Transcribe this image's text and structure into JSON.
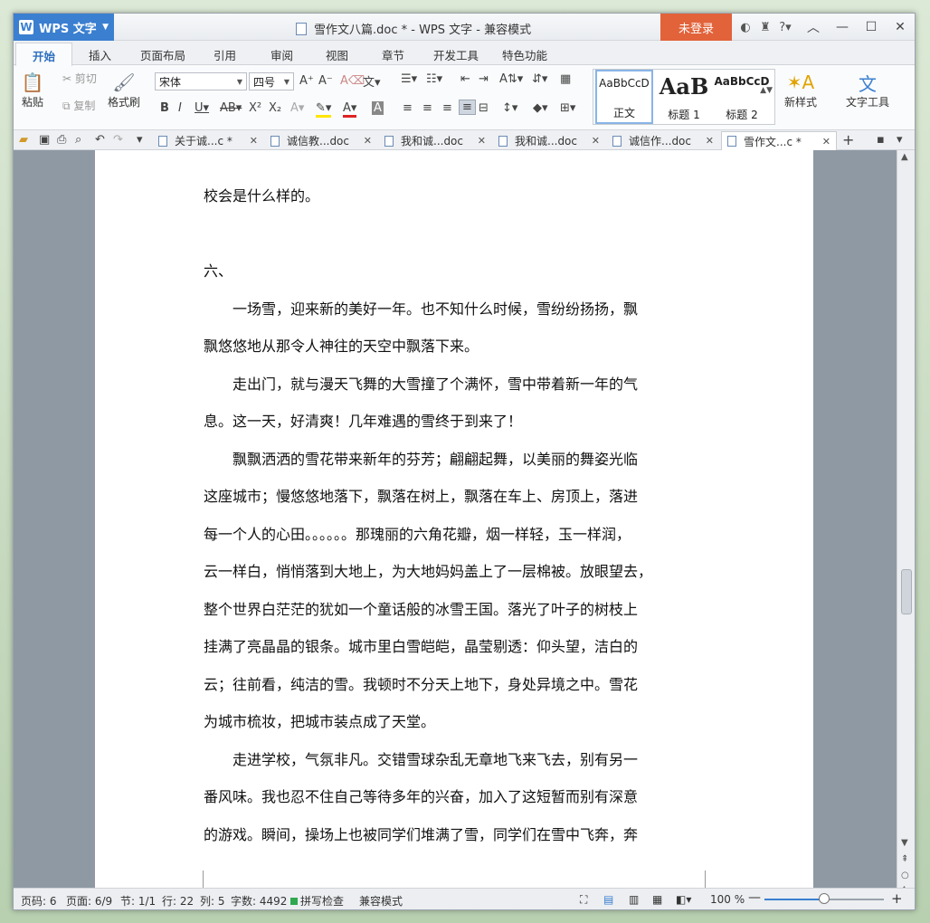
{
  "window": {
    "app_name": "WPS 文字",
    "title": "雪作文八篇.doc * - WPS 文字 - 兼容模式",
    "login_label": "未登录"
  },
  "menu_tabs": [
    "开始",
    "插入",
    "页面布局",
    "引用",
    "审阅",
    "视图",
    "章节",
    "开发工具",
    "特色功能"
  ],
  "ribbon": {
    "paste": "粘贴",
    "cut": "剪切",
    "copy": "复制",
    "format_painter": "格式刷",
    "font_name": "宋体",
    "font_size": "四号",
    "styles": [
      {
        "preview": "AaBbCcD",
        "name": "正文"
      },
      {
        "preview": "AaB",
        "name": "标题 1"
      },
      {
        "preview": "AaBbCcD",
        "name": "标题 2"
      }
    ],
    "new_style": "新样式",
    "text_tools": "文字工具"
  },
  "doc_tabs": [
    "关于诚...c *",
    "诚信教...doc",
    "我和诚...doc",
    "我和诚...doc",
    "诚信作...doc",
    "雪作文...c *"
  ],
  "document": {
    "lines": [
      "校会是什么样的。",
      "六、",
      "　　一场雪，迎来新的美好一年。也不知什么时候，雪纷纷扬扬，飘",
      "飘悠悠地从那令人神往的天空中飘落下来。",
      "　　走出门，就与漫天飞舞的大雪撞了个满怀，雪中带着新一年的气",
      "息。这一天，好清爽！几年难遇的雪终于到来了！",
      "　　飘飘洒洒的雪花带来新年的芬芳；翩翩起舞，以美丽的舞姿光临",
      "这座城市；慢悠悠地落下，飘落在树上，飘落在车上、房顶上，落进",
      "每一个人的心田。。。。。。那瑰丽的六角花瓣，烟一样轻，玉一样润，",
      "云一样白，悄悄落到大地上，为大地妈妈盖上了一层棉被。放眼望去，",
      "整个世界白茫茫的犹如一个童话般的冰雪王国。落光了叶子的树枝上",
      "挂满了亮晶晶的银条。城市里白雪皑皑，晶莹剔透：仰头望，洁白的",
      "云；往前看，纯洁的雪。我顿时不分天上地下，身处异境之中。雪花",
      "为城市梳妆，把城市装点成了天堂。",
      "　　走进学校，气氛非凡。交错雪球杂乱无章地飞来飞去，别有另一",
      "番风味。我也忍不住自己等待多年的兴奋，加入了这短暂而别有深意",
      "的游戏。瞬间，操场上也被同学们堆满了雪，同学们在雪中飞奔，奔"
    ]
  },
  "status": {
    "page_code": "页码: 6",
    "page": "页面: 6/9",
    "section": "节: 1/1",
    "row": "行: 22",
    "col": "列: 5",
    "word_count": "字数: 4492",
    "spell_check": "拼写检查",
    "compat": "兼容模式",
    "zoom": "100 %",
    "zoom_level": 0.5
  },
  "colors": {
    "accent": "#3a7fd0",
    "login": "#e2623a"
  }
}
